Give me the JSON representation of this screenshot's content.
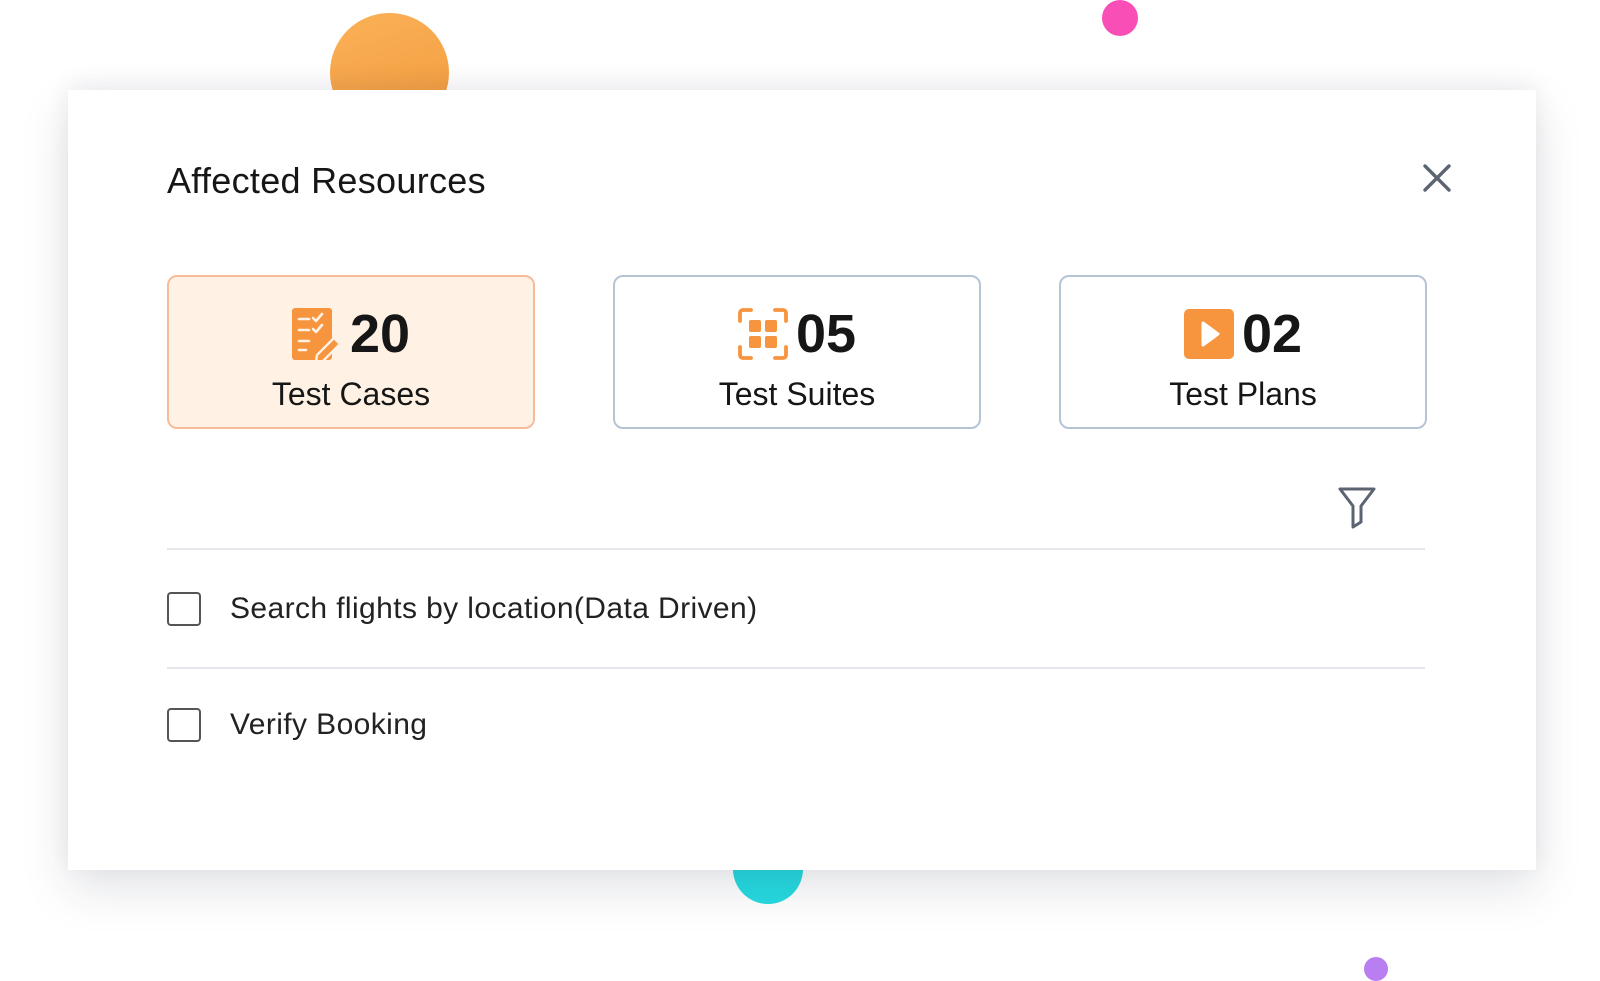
{
  "modal": {
    "title": "Affected Resources"
  },
  "cards": [
    {
      "count": "20",
      "label": "Test Cases",
      "icon": "test-cases-icon",
      "active": true
    },
    {
      "count": "05",
      "label": "Test Suites",
      "icon": "test-suites-icon",
      "active": false
    },
    {
      "count": "02",
      "label": "Test Plans",
      "icon": "test-plans-icon",
      "active": false
    }
  ],
  "list": {
    "items": [
      {
        "label": "Search flights by location(Data Driven)",
        "checked": false
      },
      {
        "label": "Verify Booking",
        "checked": false
      }
    ]
  },
  "colors": {
    "accent": "#f7943e",
    "active_card_bg": "#fff2e5",
    "active_card_border": "#f7bb9a",
    "card_border": "#b4c4d5",
    "deco_orange": "#f7a54a",
    "deco_pink": "#f94eb6",
    "deco_cyan": "#25dbe0",
    "deco_purple": "#b87ef2"
  }
}
